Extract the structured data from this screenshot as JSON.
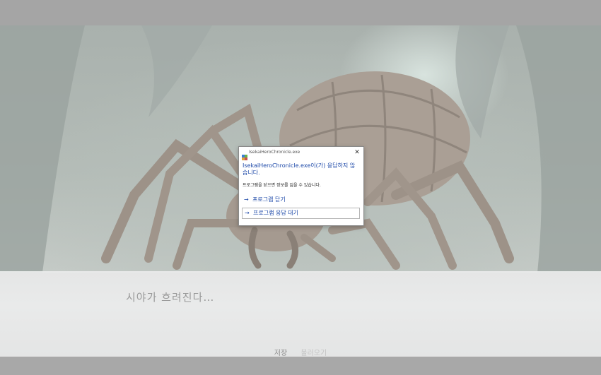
{
  "scene": {
    "dialogue": "시야가 흐려진다…",
    "menu": [
      "저장",
      "불러오기"
    ]
  },
  "dialog": {
    "title": "IsekaiHeroChronicle.exe",
    "heading": "IsekaiHeroChronicle.exe이(가) 응답하지 않습니다.",
    "subtext": "프로그램을 닫으면 정보를 잃을 수 있습니다.",
    "options": [
      "프로그램 닫기",
      "프로그램 응답 대기"
    ],
    "close_glyph": "✕",
    "arrow_glyph": "→"
  },
  "colors": {
    "accent": "#1c48a8",
    "overlay": "#a5a5a5"
  }
}
